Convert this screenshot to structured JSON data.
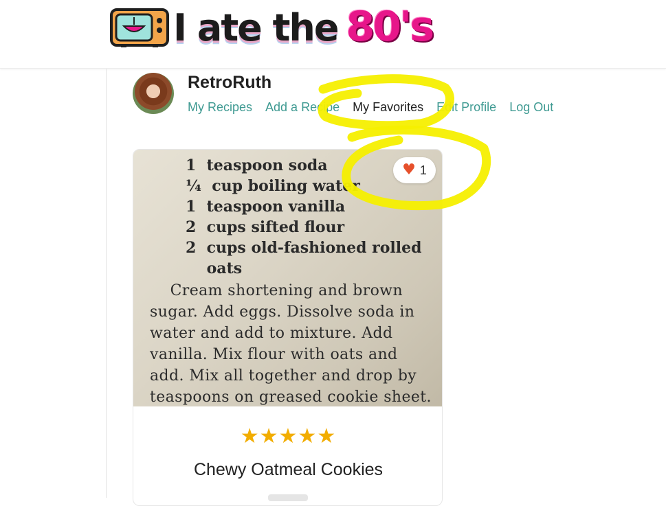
{
  "site": {
    "logo_main": "I ate the",
    "logo_accent": "80's"
  },
  "profile": {
    "username": "RetroRuth",
    "nav": [
      {
        "label": "My Recipes",
        "active": false
      },
      {
        "label": "Add a Recipe",
        "active": false
      },
      {
        "label": "My Favorites",
        "active": true
      },
      {
        "label": "Edit Profile",
        "active": false
      },
      {
        "label": "Log Out",
        "active": false
      }
    ]
  },
  "recipe_card": {
    "title": "Chewy Oatmeal Cookies",
    "rating_stars": "★★★★★",
    "favorites_count": "1",
    "image_text": {
      "ingredients": "1  teaspoon soda\n¼  cup boiling water\n1  teaspoon vanilla\n2  cups sifted flour\n2  cups old-fashioned rolled\n    oats",
      "instructions": "    Cream shortening and brown\nsugar. Add eggs. Dissolve soda in\nwater and add to mixture. Add\nvanilla. Mix flour with oats and\nadd. Mix all together and drop by\nteaspoons on greased cookie sheet."
    }
  },
  "colors": {
    "link": "#3f9a92",
    "highlight": "#f5ef00",
    "heart": "#e6502b",
    "star": "#f2ad00",
    "logo_accent": "#e7168a"
  },
  "icons": {
    "tv": "tv-icon",
    "heart": "heart-icon",
    "star": "star-icon"
  }
}
